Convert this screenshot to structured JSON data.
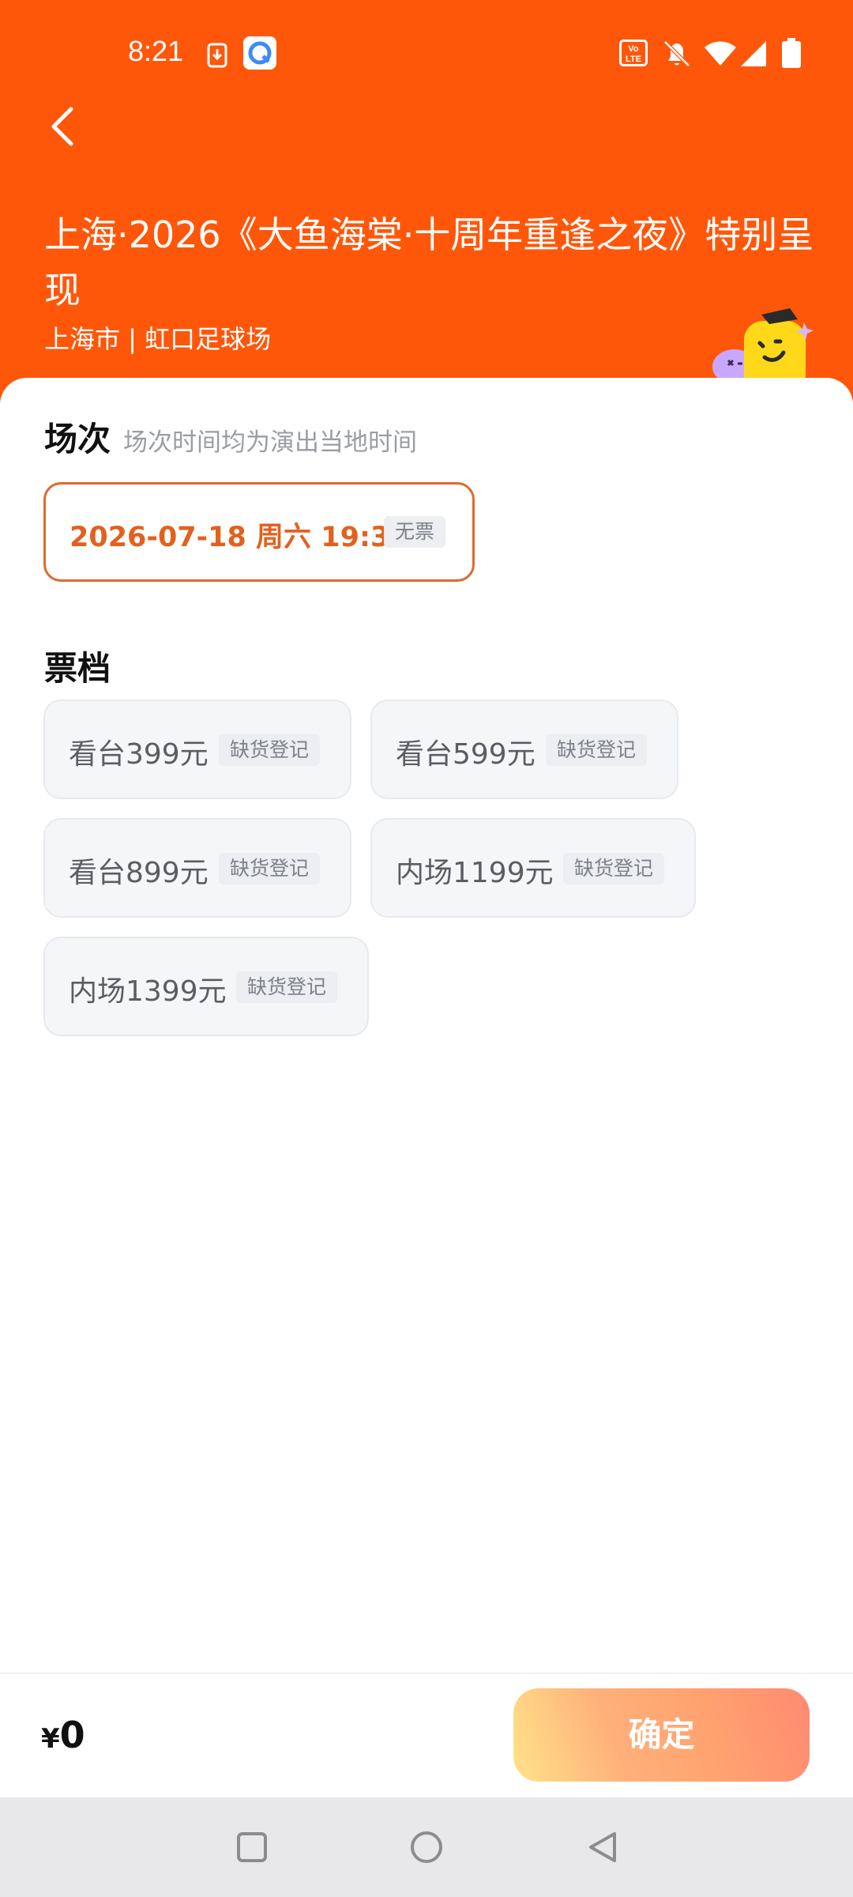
{
  "status_bar": {
    "time": "8:21"
  },
  "event": {
    "title": "上海·2026《大鱼海棠·十周年重逢之夜》特别呈现",
    "location": "上海市 | 虹口足球场"
  },
  "session_section": {
    "title": "场次",
    "hint": "场次时间均为演出当地时间",
    "sessions": [
      {
        "label": "2026-07-18  周六 19:30",
        "badge": "无票"
      }
    ]
  },
  "tier_section": {
    "title": "票档",
    "tiers": [
      {
        "label": "看台399元",
        "badge": "缺货登记"
      },
      {
        "label": "看台599元",
        "badge": "缺货登记"
      },
      {
        "label": "看台899元",
        "badge": "缺货登记"
      },
      {
        "label": "内场1199元",
        "badge": "缺货登记"
      },
      {
        "label": "内场1399元",
        "badge": "缺货登记"
      }
    ]
  },
  "footer": {
    "currency": "¥",
    "amount": "0",
    "confirm_label": "确定"
  },
  "colors": {
    "header_bg": "#ff570a",
    "accent": "#e2611f"
  }
}
